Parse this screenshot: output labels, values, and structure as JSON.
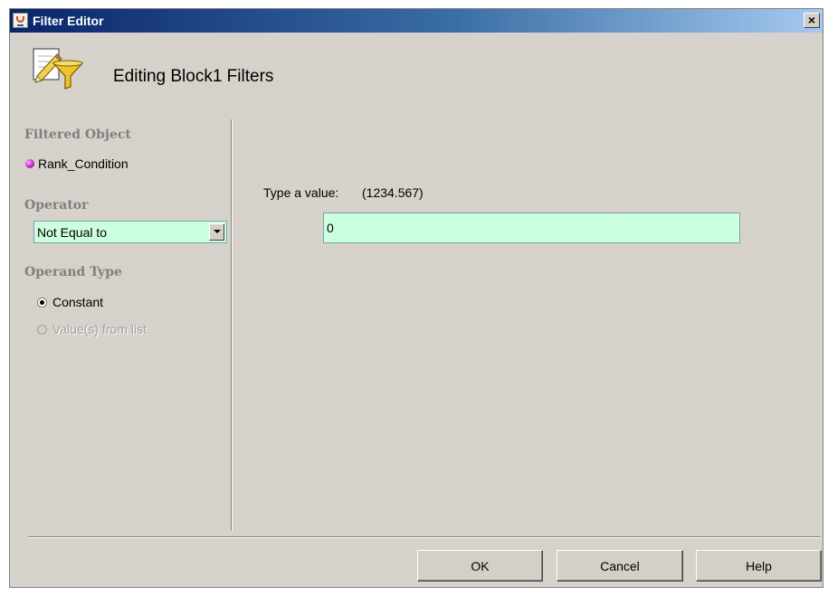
{
  "window": {
    "title": "Filter Editor",
    "close_glyph": "×"
  },
  "header": {
    "title": "Editing Block1 Filters",
    "icon": "filter-edit-icon"
  },
  "left_panel": {
    "filtered_object_label": "Filtered Object",
    "filtered_object_value": "Rank_Condition",
    "operator_label": "Operator",
    "operator_value": "Not Equal to",
    "operand_type_label": "Operand Type",
    "operand_options": [
      {
        "label": "Constant",
        "checked": true,
        "enabled": true
      },
      {
        "label": "Value(s) from list",
        "checked": false,
        "enabled": false
      }
    ]
  },
  "right_panel": {
    "value_label": "Type a value:",
    "value_hint": "(1234.567)",
    "value": "0"
  },
  "buttons": {
    "ok": "OK",
    "cancel": "Cancel",
    "help": "Help"
  },
  "colors": {
    "dialog_bg": "#d4d0c8",
    "titlebar_start": "#0a246a",
    "titlebar_end": "#a6caf0",
    "input_bg": "#ccffdd",
    "section_label": "#808080"
  }
}
